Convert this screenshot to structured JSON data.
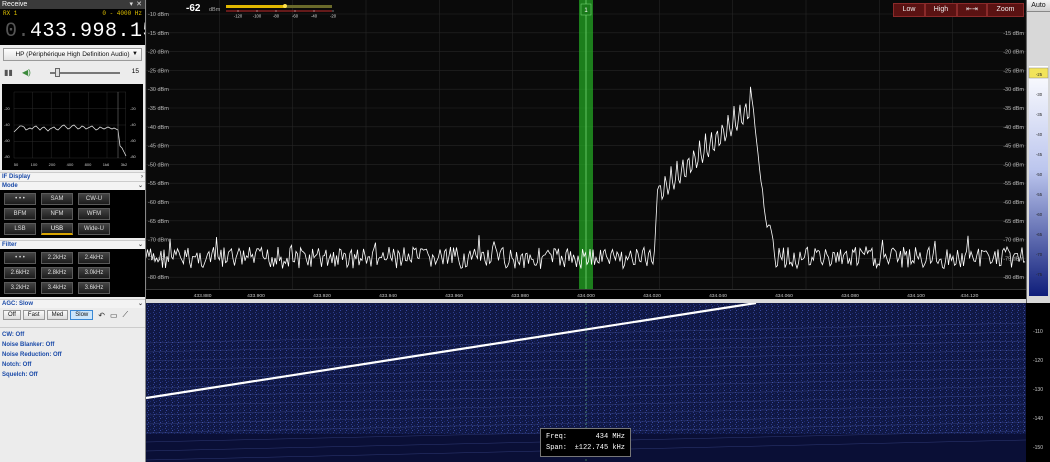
{
  "window": {
    "title": "Receive",
    "pin_icon": "pin-icon",
    "close_icon": "close-icon"
  },
  "rx": {
    "label": "RX 1",
    "range": "0 - 4000 Hz"
  },
  "frequency": {
    "dim_prefix": "0.",
    "value": "433.998.150"
  },
  "audio_device": {
    "label": "HP (Périphérique High Definition Audio)"
  },
  "volume": {
    "value": "15",
    "level_fraction": 0.1
  },
  "mini_spectrum": {
    "y_ticks": [
      "-20",
      "-40",
      "-60",
      "-80"
    ],
    "x_ticks": [
      "50",
      "100",
      "200",
      "400",
      "800",
      "1k6",
      "3k2"
    ]
  },
  "if_display": {
    "label": "IF Display"
  },
  "mode": {
    "label": "Mode",
    "buttons": [
      "• • •",
      "SAM",
      "CW-U",
      "BFM",
      "NFM",
      "WFM",
      "LSB",
      "USB",
      "Wide-U"
    ],
    "selected": "USB"
  },
  "filter": {
    "label": "Filter",
    "buttons": [
      "• • •",
      "2.2kHz",
      "2.4kHz",
      "2.6kHz",
      "2.8kHz",
      "3.0kHz",
      "3.2kHz",
      "3.4kHz",
      "3.6kHz"
    ]
  },
  "agc": {
    "label": "AGC: Slow",
    "buttons": [
      "Off",
      "Fast",
      "Med",
      "Slow"
    ],
    "selected": "Slow"
  },
  "options": [
    "CW: Off",
    "Noise Blanker: Off",
    "Noise Reduction: Off",
    "Notch: Off",
    "Squelch: Off"
  ],
  "signal": {
    "value": "-62",
    "unit": "dBm",
    "meter_scale": [
      "-120",
      "-100",
      "-80",
      "-60",
      "-40",
      "-20"
    ]
  },
  "toolbar": {
    "low": "Low",
    "high": "High",
    "fit": "⇤⇥",
    "zoom": "Zoom"
  },
  "spectrum": {
    "db_labels": [
      "-10 dBm",
      "-15 dBm",
      "-20 dBm",
      "-25 dBm",
      "-30 dBm",
      "-35 dBm",
      "-40 dBm",
      "-45 dBm",
      "-50 dBm",
      "-55 dBm",
      "-60 dBm",
      "-65 dBm",
      "-70 dBm",
      "-75 dBm",
      "-80 dBm"
    ],
    "freq_labels": [
      "433.880",
      "433.900",
      "433.920",
      "433.940",
      "433.960",
      "433.980",
      "434.000",
      "434.020",
      "434.040",
      "434.060",
      "434.080",
      "434.100",
      "434.120"
    ],
    "marker_label": "1",
    "bright_color": "#ffffff",
    "marker_color": "#2ec42e"
  },
  "autoscale": {
    "label": "Auto"
  },
  "wf_scale": [
    "-110",
    "-120",
    "-130",
    "-140",
    "-150"
  ],
  "tooltip": {
    "freq_label": "Freq:",
    "freq_value": "434 MHz",
    "span_label": "Span:",
    "span_value": "±122.745 kHz"
  }
}
